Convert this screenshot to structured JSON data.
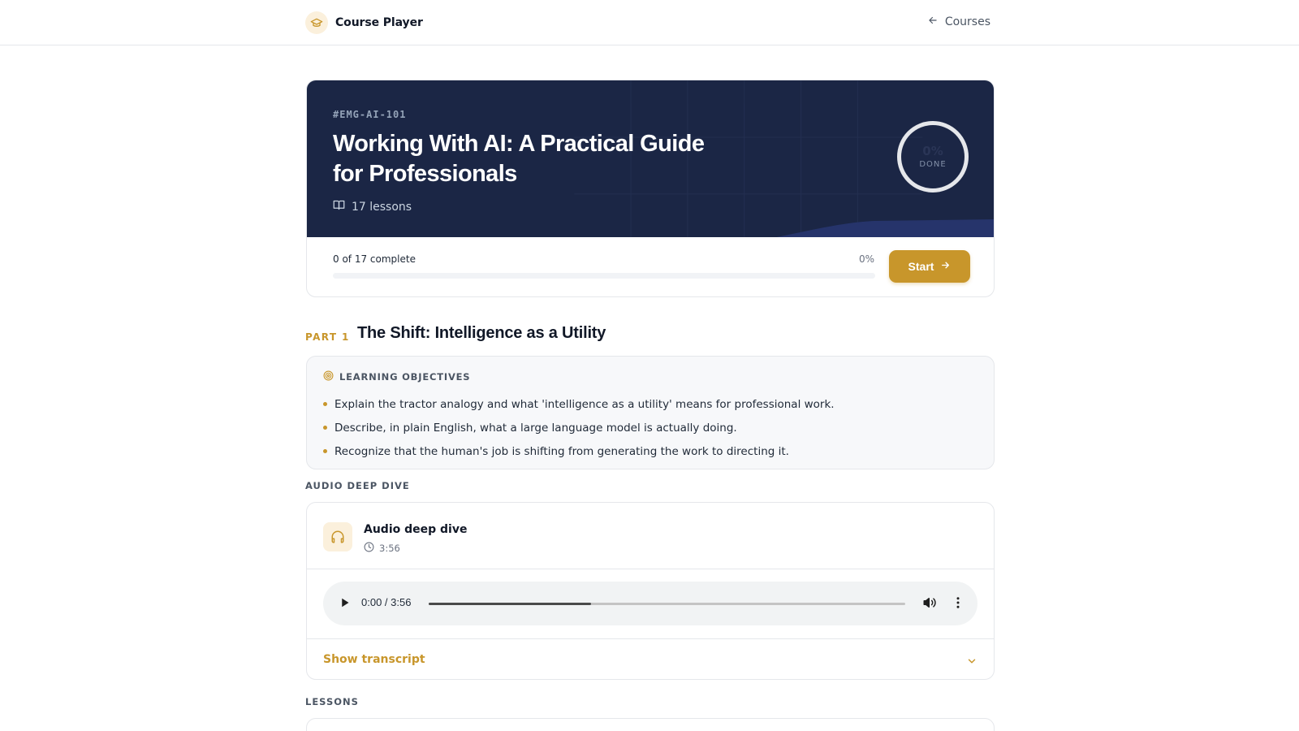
{
  "header": {
    "app_name": "Course Player",
    "back_label": "Courses",
    "icons": {
      "logo": "graduation-cap-icon",
      "back": "arrow-left-icon"
    }
  },
  "course": {
    "code": "#EMG-AI-101",
    "title": "Working With AI: A Practical Guide for Professionals",
    "lessons_count": "17 lessons",
    "ring_percent": "0%",
    "ring_label": "DONE",
    "progress_text": "0 of 17 complete",
    "progress_percent": "0%",
    "progress_value": 0,
    "start_label": "Start"
  },
  "part": {
    "label": "PART 1",
    "title": "The Shift: Intelligence as a Utility"
  },
  "objectives": {
    "heading": "LEARNING OBJECTIVES",
    "items": [
      "Explain the tractor analogy and what 'intelligence as a utility' means for professional work.",
      "Describe, in plain English, what a large language model is actually doing.",
      "Recognize that the human's job is shifting from generating the work to directing it."
    ]
  },
  "audio": {
    "section_label": "AUDIO DEEP DIVE",
    "title": "Audio deep dive",
    "duration": "3:56",
    "player_time": "0:00 / 3:56",
    "transcript_label": "Show transcript"
  },
  "lessons": {
    "section_label": "LESSONS"
  },
  "colors": {
    "accent": "#c8962b",
    "hero_bg": "#1b2645",
    "accent_soft": "#fbf0dc"
  }
}
